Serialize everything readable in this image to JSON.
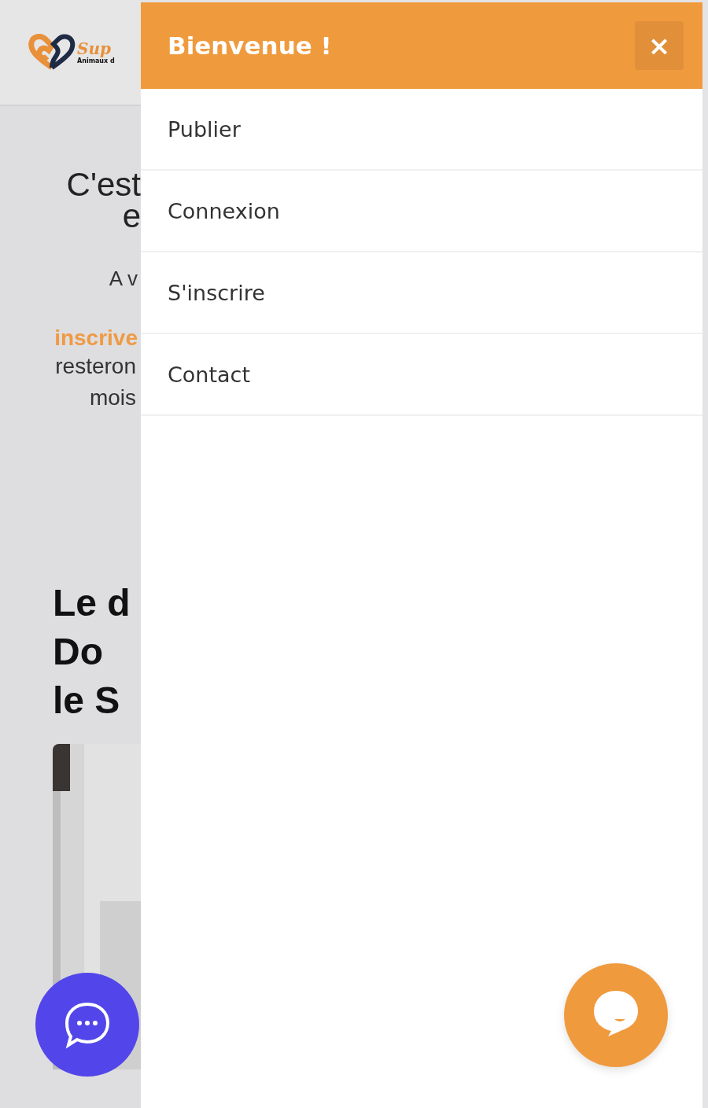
{
  "page": {
    "logo": {
      "name": "Sup",
      "tagline": "Animaux d"
    },
    "intro": {
      "heading": [
        "C'est",
        "e"
      ],
      "lead": "A v",
      "highlight": "inscrive",
      "body": [
        "resteron",
        "mois"
      ]
    },
    "section": {
      "heading": [
        "Le d",
        "Do",
        "le S"
      ],
      "media": {
        "kind": "picture"
      }
    }
  },
  "drawer": {
    "title": "Bienvenue !",
    "close": "×",
    "items": [
      {
        "label": "Publier"
      },
      {
        "label": "Connexion"
      },
      {
        "label": "S'inscrire"
      },
      {
        "label": "Contact"
      }
    ]
  }
}
